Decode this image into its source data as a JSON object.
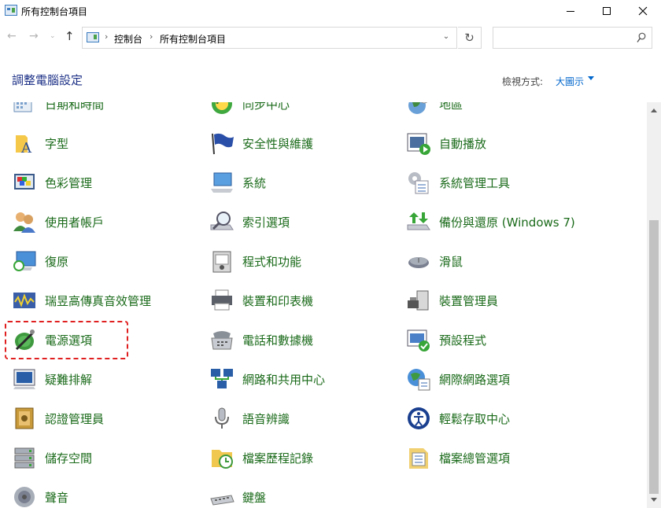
{
  "window": {
    "title": "所有控制台項目",
    "minimize_icon": "minimize-icon",
    "maximize_icon": "maximize-icon",
    "close_icon": "close-icon"
  },
  "nav": {
    "breadcrumb": [
      "控制台",
      "所有控制台項目"
    ],
    "search_placeholder": ""
  },
  "header": {
    "title": "調整電腦設定",
    "view_by_label": "檢視方式:",
    "view_by_value": "大圖示"
  },
  "items": [
    {
      "label": "日期和時間",
      "icon": "clock-icon"
    },
    {
      "label": "同步中心",
      "icon": "sync-icon"
    },
    {
      "label": "地區",
      "icon": "region-icon"
    },
    {
      "label": "字型",
      "icon": "font-icon"
    },
    {
      "label": "安全性與維護",
      "icon": "flag-icon"
    },
    {
      "label": "自動播放",
      "icon": "autoplay-icon"
    },
    {
      "label": "色彩管理",
      "icon": "color-icon"
    },
    {
      "label": "系統",
      "icon": "system-icon"
    },
    {
      "label": "系統管理工具",
      "icon": "admin-tools-icon"
    },
    {
      "label": "使用者帳戶",
      "icon": "users-icon"
    },
    {
      "label": "索引選項",
      "icon": "index-icon"
    },
    {
      "label": "備份與還原 (Windows 7)",
      "icon": "backup-icon"
    },
    {
      "label": "復原",
      "icon": "recovery-icon"
    },
    {
      "label": "程式和功能",
      "icon": "programs-icon"
    },
    {
      "label": "滑鼠",
      "icon": "mouse-icon"
    },
    {
      "label": "瑞昱高傳真音效管理",
      "icon": "audio-manager-icon"
    },
    {
      "label": "裝置和印表機",
      "icon": "printer-icon"
    },
    {
      "label": "裝置管理員",
      "icon": "device-manager-icon"
    },
    {
      "label": "電源選項",
      "icon": "power-icon"
    },
    {
      "label": "電話和數據機",
      "icon": "phone-icon"
    },
    {
      "label": "預設程式",
      "icon": "default-programs-icon"
    },
    {
      "label": "疑難排解",
      "icon": "troubleshoot-icon"
    },
    {
      "label": "網路和共用中心",
      "icon": "network-icon"
    },
    {
      "label": "網際網路選項",
      "icon": "internet-options-icon"
    },
    {
      "label": "認證管理員",
      "icon": "credential-icon"
    },
    {
      "label": "語音辨識",
      "icon": "microphone-icon"
    },
    {
      "label": "輕鬆存取中心",
      "icon": "ease-of-access-icon"
    },
    {
      "label": "儲存空間",
      "icon": "storage-icon"
    },
    {
      "label": "檔案歷程記錄",
      "icon": "file-history-icon"
    },
    {
      "label": "檔案總管選項",
      "icon": "explorer-options-icon"
    },
    {
      "label": "聲音",
      "icon": "speaker-icon"
    },
    {
      "label": "鍵盤",
      "icon": "keyboard-icon"
    }
  ],
  "colors": {
    "link_green": "#1a6a1a",
    "title_blue": "#1e3287",
    "accent_blue": "#0066cc",
    "highlight_red": "#e02020"
  }
}
